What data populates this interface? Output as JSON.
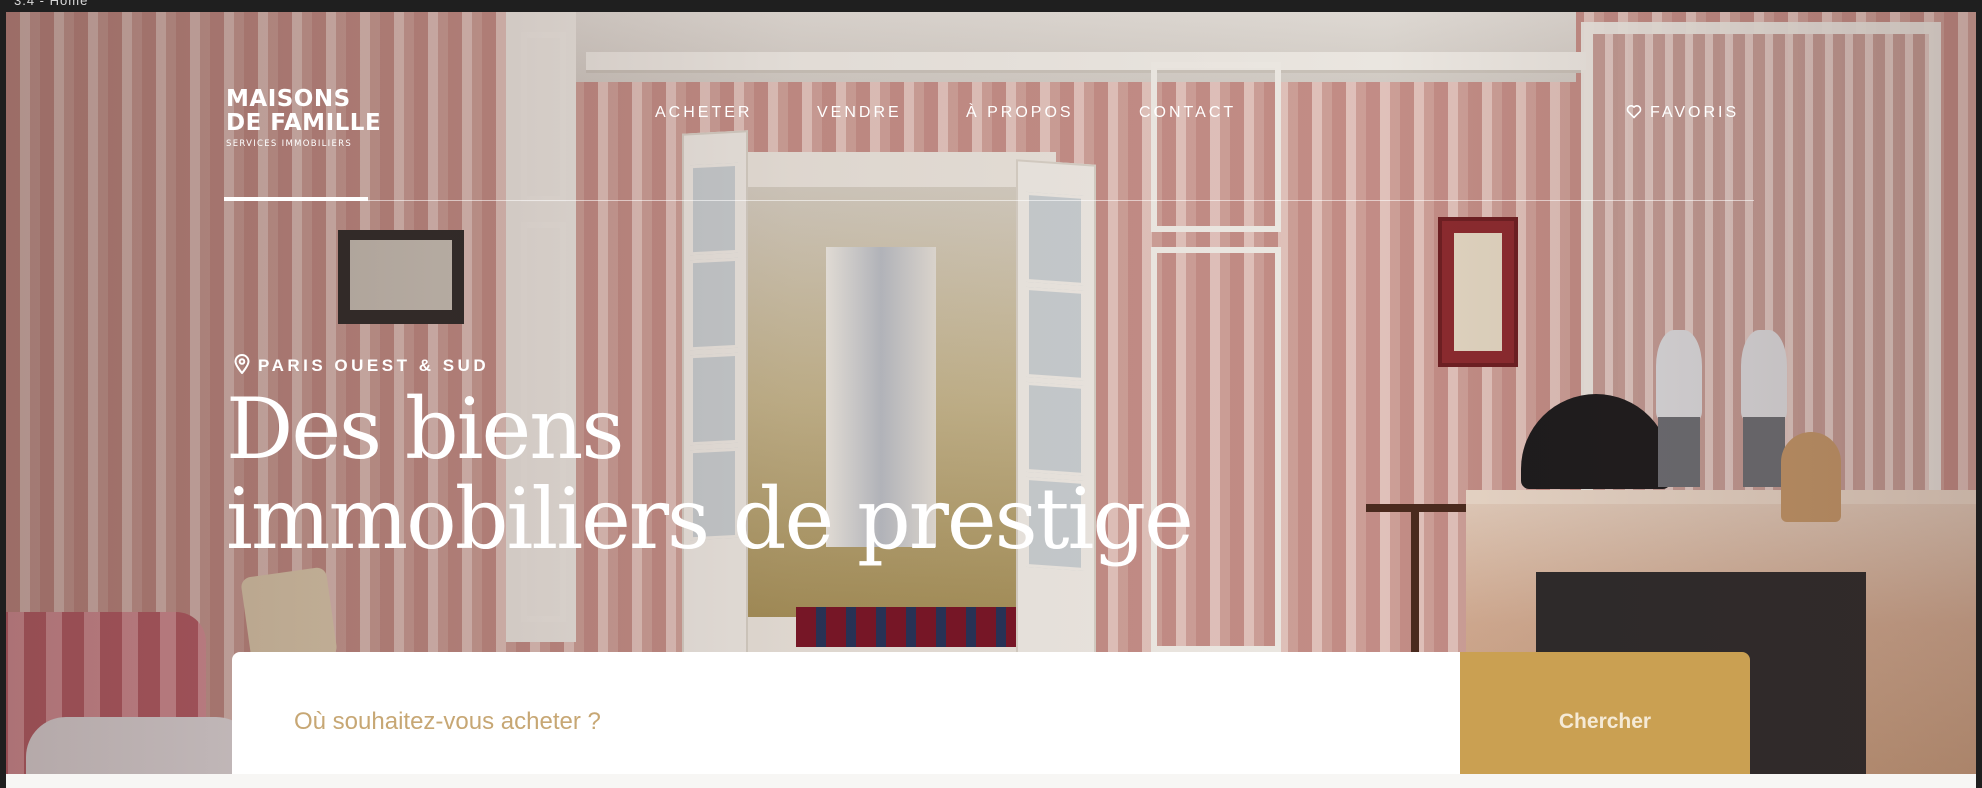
{
  "browser": {
    "tab_label": "3.4 - Home"
  },
  "brand": {
    "line1": "MAISONS",
    "line2": "DE FAMILLE",
    "tagline": "SERVICES IMMOBILIERS"
  },
  "nav": {
    "items": [
      {
        "label": "ACHETER"
      },
      {
        "label": "VENDRE"
      },
      {
        "label": "À PROPOS"
      },
      {
        "label": "CONTACT"
      }
    ],
    "favorites_label": "FAVORIS",
    "favorites_icon": "heart-icon"
  },
  "hero": {
    "location_icon": "map-pin-icon",
    "location": "PARIS OUEST & SUD",
    "headline_line1": "Des biens",
    "headline_line2": "immobiliers de prestige"
  },
  "search": {
    "placeholder": "Où souhaitez-vous acheter ?",
    "value": "",
    "button_label": "Chercher"
  },
  "colors": {
    "accent_gold": "#caa052",
    "placeholder_gold": "#c7a774",
    "text_on_hero": "#ffffff"
  }
}
